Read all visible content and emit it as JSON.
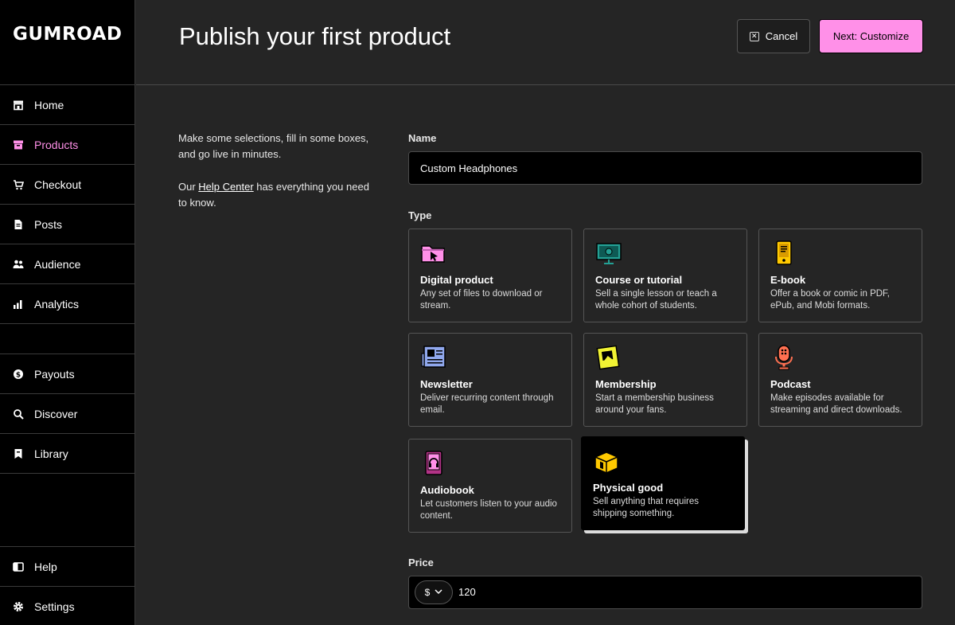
{
  "brand": {
    "logo_text": "GUMROAD",
    "accent": "#ff90e8"
  },
  "sidebar": {
    "items": [
      {
        "label": "Home",
        "icon": "store-icon"
      },
      {
        "label": "Products",
        "icon": "archive-icon",
        "active": true
      },
      {
        "label": "Checkout",
        "icon": "cart-icon"
      },
      {
        "label": "Posts",
        "icon": "document-icon"
      },
      {
        "label": "Audience",
        "icon": "people-icon"
      },
      {
        "label": "Analytics",
        "icon": "bar-chart-icon"
      }
    ],
    "items2": [
      {
        "label": "Payouts",
        "icon": "dollar-icon"
      },
      {
        "label": "Discover",
        "icon": "search-icon"
      },
      {
        "label": "Library",
        "icon": "bookmark-icon"
      }
    ],
    "items3": [
      {
        "label": "Help",
        "icon": "book-icon"
      },
      {
        "label": "Settings",
        "icon": "gear-icon"
      }
    ]
  },
  "header": {
    "title": "Publish your first product",
    "cancel_label": "Cancel",
    "next_label": "Next: Customize"
  },
  "intro": {
    "line1": "Make some selections, fill in some boxes, and go live in minutes.",
    "line2_prefix": "Our ",
    "line2_link": "Help Center",
    "line2_suffix": " has everything you need to know."
  },
  "form": {
    "name_label": "Name",
    "name_value": "Custom Headphones",
    "type_label": "Type",
    "types": [
      {
        "title": "Digital product",
        "desc": "Any set of files to download or stream.",
        "icon": "folder-cursor-icon"
      },
      {
        "title": "Course or tutorial",
        "desc": "Sell a single lesson or teach a whole cohort of students.",
        "icon": "presentation-screen-icon"
      },
      {
        "title": "E-book",
        "desc": "Offer a book or comic in PDF, ePub, and Mobi formats.",
        "icon": "ebook-reader-icon"
      },
      {
        "title": "Newsletter",
        "desc": "Deliver recurring content through email.",
        "icon": "newspaper-icon"
      },
      {
        "title": "Membership",
        "desc": "Start a membership business around your fans.",
        "icon": "membership-card-icon"
      },
      {
        "title": "Podcast",
        "desc": "Make episodes available for streaming and direct downloads.",
        "icon": "microphone-icon"
      },
      {
        "title": "Audiobook",
        "desc": "Let customers listen to your audio content.",
        "icon": "audiobook-icon"
      },
      {
        "title": "Physical good",
        "desc": "Sell anything that requires shipping something.",
        "icon": "package-box-icon",
        "selected": true
      }
    ],
    "price_label": "Price",
    "currency": "$",
    "price_value": "120"
  }
}
